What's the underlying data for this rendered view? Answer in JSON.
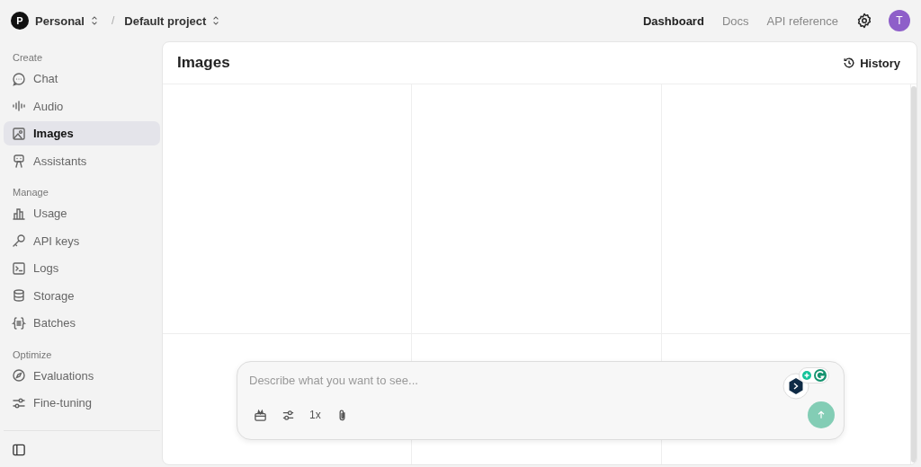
{
  "breadcrumb": {
    "org_initial": "P",
    "org": "Personal",
    "separator": "/",
    "project": "Default project"
  },
  "top_nav": [
    {
      "label": "Dashboard",
      "selected": true
    },
    {
      "label": "Docs",
      "selected": false
    },
    {
      "label": "API reference",
      "selected": false
    }
  ],
  "avatar": "T",
  "sidebar": {
    "sections": [
      {
        "label": "Create",
        "items": [
          {
            "label": "Chat",
            "selected": false
          },
          {
            "label": "Audio",
            "selected": false
          },
          {
            "label": "Images",
            "selected": true
          },
          {
            "label": "Assistants",
            "selected": false
          }
        ]
      },
      {
        "label": "Manage",
        "items": [
          {
            "label": "Usage",
            "selected": false
          },
          {
            "label": "API keys",
            "selected": false
          },
          {
            "label": "Logs",
            "selected": false
          },
          {
            "label": "Storage",
            "selected": false
          },
          {
            "label": "Batches",
            "selected": false
          }
        ]
      },
      {
        "label": "Optimize",
        "items": [
          {
            "label": "Evaluations",
            "selected": false
          },
          {
            "label": "Fine-tuning",
            "selected": false
          }
        ]
      }
    ]
  },
  "panel": {
    "title": "Images",
    "history": "History"
  },
  "prompt": {
    "placeholder": "Describe what you want to see...",
    "count": "1x"
  }
}
